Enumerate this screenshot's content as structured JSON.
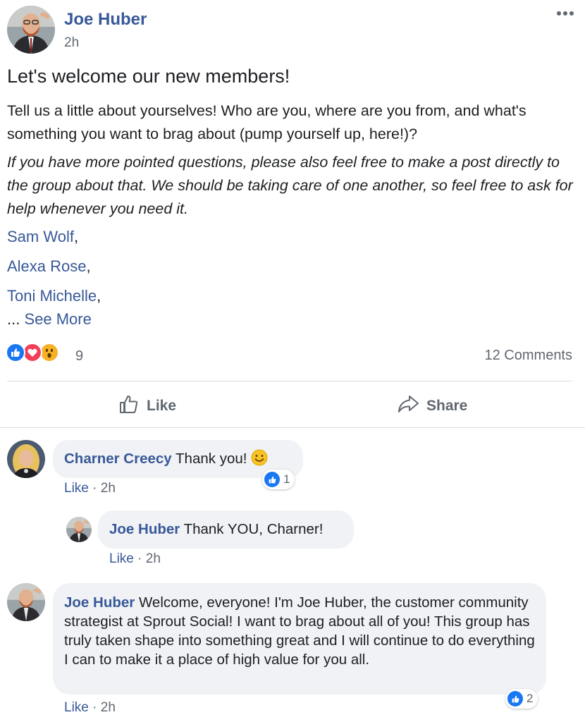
{
  "post": {
    "author": "Joe Huber",
    "time": "2h",
    "title": "Let's welcome our new members!",
    "paragraph1": "Tell us a little about yourselves! Who are you, where are you from, and what's something you want to brag about (pump yourself up, here!)?",
    "paragraph2": "If you have more pointed questions, please also feel free to make a post directly to the group about that. We should be taking care of one another, so feel free to ask for help whenever you need it.",
    "mentions": [
      {
        "name": "Sam Wolf",
        "suffix": ","
      },
      {
        "name": "Alexa Rose",
        "suffix": ","
      },
      {
        "name": "Toni Michelle",
        "suffix": ","
      }
    ],
    "ellipsis": "...",
    "see_more": "See More",
    "reactions": [
      "like-icon",
      "love-icon",
      "wow-icon"
    ],
    "reaction_count": "9",
    "comments_count": "12 Comments"
  },
  "actions": {
    "like": "Like",
    "share": "Share"
  },
  "comments": [
    {
      "author": "Charner Creecy",
      "text": "Thank you!",
      "emoji": "smile-emoji",
      "like_label": "Like",
      "separator": "·",
      "time": "2h",
      "likes": "1"
    },
    {
      "author": "Joe Huber",
      "text": "Thank YOU, Charner!",
      "like_label": "Like",
      "separator": "·",
      "time": "2h"
    },
    {
      "author": "Joe Huber",
      "text": "Welcome, everyone! I'm Joe Huber, the customer community strategist at Sprout Social! I want to brag about all of you! This group has truly taken shape into something great and I will continue to do everything I can to make it a place of high value for you all.",
      "like_label": "Like",
      "separator": "·",
      "time": "2h",
      "likes": "2"
    }
  ],
  "colors": {
    "link": "#385898",
    "muted": "#606770",
    "like_blue": "#1877f2",
    "love_red": "#f33e58",
    "wow_yellow": "#f7b125",
    "bubble": "#f0f2f5",
    "divider": "#dadde1"
  }
}
